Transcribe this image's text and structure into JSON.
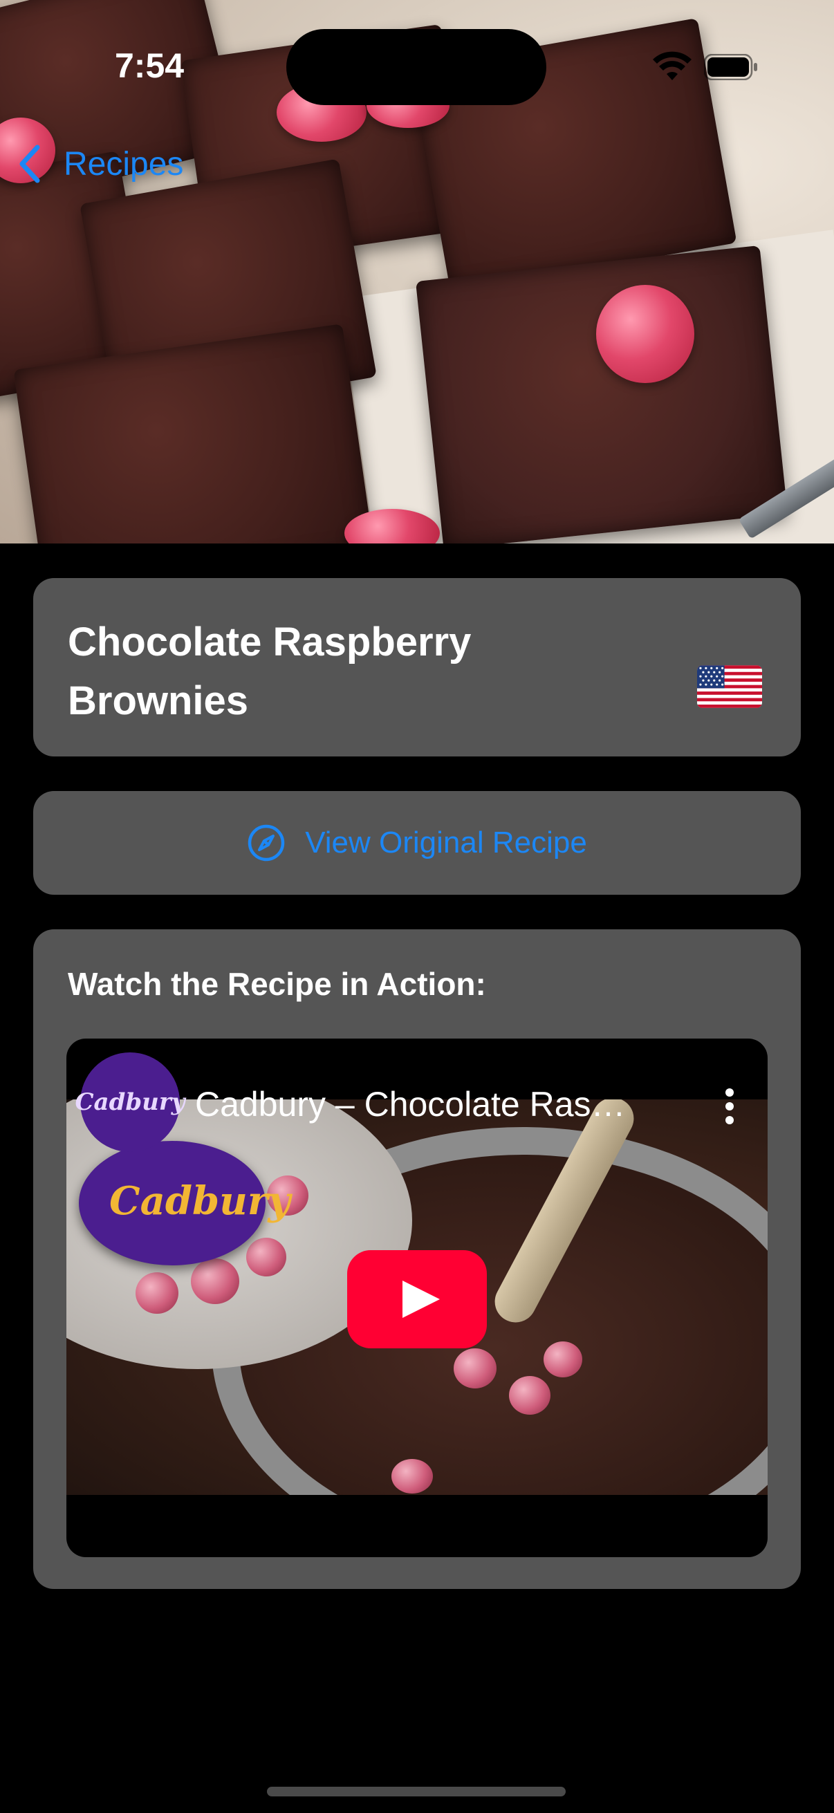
{
  "status_bar": {
    "time": "7:54"
  },
  "nav": {
    "back_label": "Recipes"
  },
  "recipe": {
    "title": "Chocolate Raspberry Brownies",
    "area_flag": "us-flag-icon"
  },
  "source_link": {
    "label": "View Original Recipe",
    "icon": "compass-icon"
  },
  "video": {
    "heading": "Watch the Recipe in Action:",
    "channel_avatar_text": "Cadbury",
    "title": "Cadbury – Chocolate Ras…",
    "overlay_logo_text": "Cadbury"
  },
  "colors": {
    "accent": "#1C87F5",
    "card": "#555555",
    "background": "#000000",
    "youtube_red": "#FF0033"
  }
}
